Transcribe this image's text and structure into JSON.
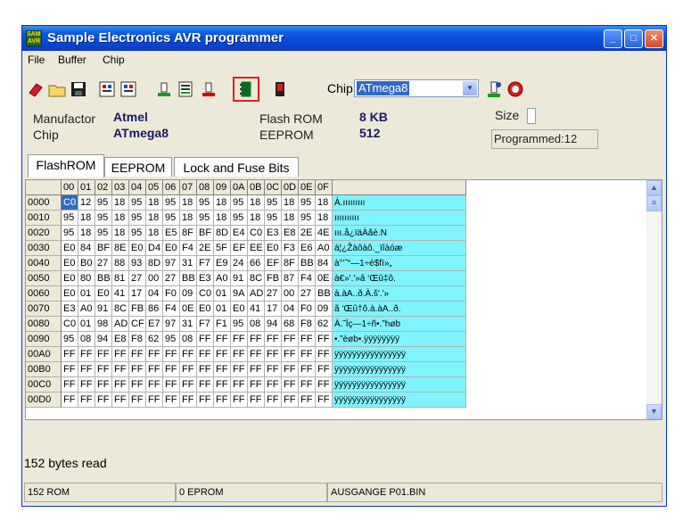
{
  "window": {
    "title": "Sample Electronics AVR programmer",
    "icon_text": "SAMPLE AVR"
  },
  "menu": [
    "File",
    "Buffer",
    "Chip"
  ],
  "toolbar": {
    "chip_label": "Chip",
    "chip_value": "ATmega8"
  },
  "info": {
    "manufacturer_label": "Manufactor",
    "manufacturer_value": "Atmel",
    "chip_label": "Chip",
    "chip_value": "ATmega8",
    "flash_label": "Flash ROM",
    "flash_value": "8 KB",
    "eeprom_label": "EEPROM",
    "eeprom_value": "512",
    "size_label": "Size",
    "programmed": "Programmed:12"
  },
  "tabs": [
    "FlashROM",
    "EEPROM",
    "Lock and Fuse Bits"
  ],
  "grid": {
    "columns": [
      "00",
      "01",
      "02",
      "03",
      "04",
      "05",
      "06",
      "07",
      "08",
      "09",
      "0A",
      "0B",
      "0C",
      "0D",
      "0E",
      "0F"
    ],
    "rows": [
      {
        "addr": "0000",
        "bytes": [
          "C0",
          "12",
          "95",
          "18",
          "95",
          "18",
          "95",
          "18",
          "95",
          "18",
          "95",
          "18",
          "95",
          "18",
          "95",
          "18"
        ],
        "ascii": "À.ııııııııı"
      },
      {
        "addr": "0010",
        "bytes": [
          "95",
          "18",
          "95",
          "18",
          "95",
          "18",
          "95",
          "18",
          "95",
          "18",
          "95",
          "18",
          "95",
          "18",
          "95",
          "18"
        ],
        "ascii": "ıııııııııı"
      },
      {
        "addr": "0020",
        "bytes": [
          "95",
          "18",
          "95",
          "18",
          "95",
          "18",
          "E5",
          "8F",
          "BF",
          "8D",
          "E4",
          "C0",
          "E3",
          "E8",
          "2E",
          "4E"
        ],
        "ascii": "ııı.å¿ïäÀãè.N"
      },
      {
        "addr": "0030",
        "bytes": [
          "E0",
          "84",
          "BF",
          "8E",
          "E0",
          "D4",
          "E0",
          "F4",
          "2E",
          "5F",
          "EF",
          "EE",
          "E0",
          "F3",
          "E6",
          "A0"
        ],
        "ascii": "à¦¿Žàõàô._ïîàóæ"
      },
      {
        "addr": "0040",
        "bytes": [
          "E0",
          "B0",
          "27",
          "88",
          "93",
          "8D",
          "97",
          "31",
          "F7",
          "E9",
          "24",
          "66",
          "EF",
          "8F",
          "BB",
          "84"
        ],
        "ascii": "à°'ˆ“—1÷é$fï»„"
      },
      {
        "addr": "0050",
        "bytes": [
          "E0",
          "80",
          "BB",
          "81",
          "27",
          "00",
          "27",
          "BB",
          "E3",
          "A0",
          "91",
          "8C",
          "FB",
          "87",
          "F4",
          "0E"
        ],
        "ascii": "à€»'.'»ã ‘Œû‡ô."
      },
      {
        "addr": "0060",
        "bytes": [
          "E0",
          "01",
          "E0",
          "41",
          "17",
          "04",
          "F0",
          "09",
          "C0",
          "01",
          "9A",
          "AD",
          "27",
          "00",
          "27",
          "BB"
        ],
        "ascii": "à.àA..ð.À.š­'.'»"
      },
      {
        "addr": "0070",
        "bytes": [
          "E3",
          "A0",
          "91",
          "8C",
          "FB",
          "86",
          "F4",
          "0E",
          "E0",
          "01",
          "E0",
          "41",
          "17",
          "04",
          "F0",
          "09"
        ],
        "ascii": "ã ‘Œû†ô.à.àA..ð."
      },
      {
        "addr": "0080",
        "bytes": [
          "C0",
          "01",
          "98",
          "AD",
          "CF",
          "E7",
          "97",
          "31",
          "F7",
          "F1",
          "95",
          "08",
          "94",
          "68",
          "F8",
          "62"
        ],
        "ascii": "À.˜­Ïç—1÷ñ•.”høb"
      },
      {
        "addr": "0090",
        "bytes": [
          "95",
          "08",
          "94",
          "E8",
          "F8",
          "62",
          "95",
          "08",
          "FF",
          "FF",
          "FF",
          "FF",
          "FF",
          "FF",
          "FF",
          "FF"
        ],
        "ascii": "•.”èøb•.ÿÿÿÿÿÿÿÿ"
      },
      {
        "addr": "00A0",
        "bytes": [
          "FF",
          "FF",
          "FF",
          "FF",
          "FF",
          "FF",
          "FF",
          "FF",
          "FF",
          "FF",
          "FF",
          "FF",
          "FF",
          "FF",
          "FF",
          "FF"
        ],
        "ascii": "ÿÿÿÿÿÿÿÿÿÿÿÿÿÿÿÿ"
      },
      {
        "addr": "00B0",
        "bytes": [
          "FF",
          "FF",
          "FF",
          "FF",
          "FF",
          "FF",
          "FF",
          "FF",
          "FF",
          "FF",
          "FF",
          "FF",
          "FF",
          "FF",
          "FF",
          "FF"
        ],
        "ascii": "ÿÿÿÿÿÿÿÿÿÿÿÿÿÿÿÿ"
      },
      {
        "addr": "00C0",
        "bytes": [
          "FF",
          "FF",
          "FF",
          "FF",
          "FF",
          "FF",
          "FF",
          "FF",
          "FF",
          "FF",
          "FF",
          "FF",
          "FF",
          "FF",
          "FF",
          "FF"
        ],
        "ascii": "ÿÿÿÿÿÿÿÿÿÿÿÿÿÿÿÿ"
      },
      {
        "addr": "00D0",
        "bytes": [
          "FF",
          "FF",
          "FF",
          "FF",
          "FF",
          "FF",
          "FF",
          "FF",
          "FF",
          "FF",
          "FF",
          "FF",
          "FF",
          "FF",
          "FF",
          "FF"
        ],
        "ascii": "ÿÿÿÿÿÿÿÿÿÿÿÿÿÿÿÿ"
      }
    ]
  },
  "bytes_read": "152 bytes read",
  "status": [
    "152 ROM",
    "0 EPROM",
    "AUSGANGE P01.BIN"
  ]
}
